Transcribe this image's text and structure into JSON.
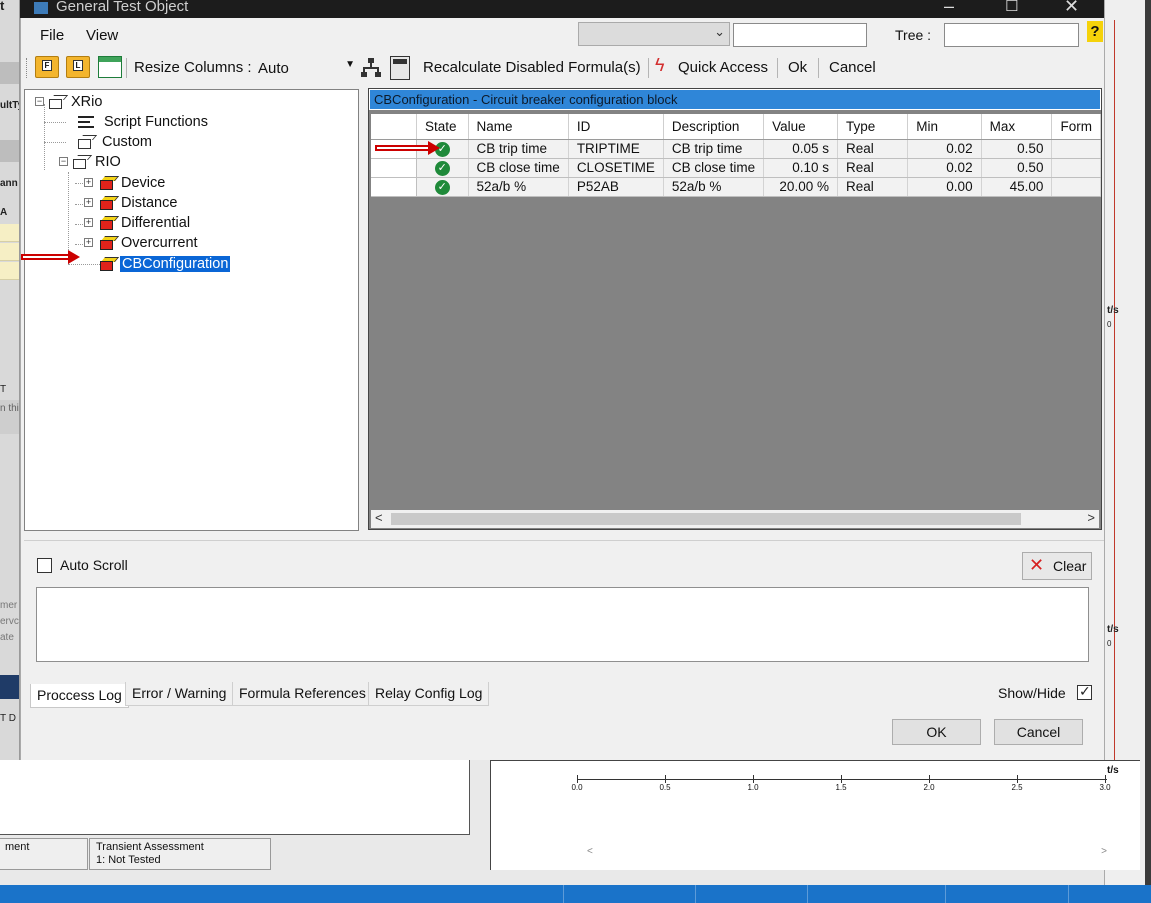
{
  "window": {
    "title": "General Test Object"
  },
  "menu": [
    "File",
    "View"
  ],
  "search": {
    "tree_label": "Tree :",
    "help": "?"
  },
  "toolbar": {
    "folder1": "F",
    "folder2": "L",
    "resize_label": "Resize Columns :",
    "resize_value": "Auto",
    "recalc_label": "Recalculate Disabled Formula(s)",
    "quick_access_label": "Quick Access",
    "ok_label": "Ok",
    "cancel_label": "Cancel"
  },
  "tree": [
    {
      "label": "XRio"
    },
    {
      "label": "Script Functions"
    },
    {
      "label": "Custom"
    },
    {
      "label": "RIO"
    },
    {
      "label": "Device"
    },
    {
      "label": "Distance"
    },
    {
      "label": "Differential"
    },
    {
      "label": "Overcurrent"
    },
    {
      "label": "CBConfiguration"
    }
  ],
  "grid": {
    "title": "CBConfiguration - Circuit breaker configuration block",
    "columns": [
      "State",
      "Name",
      "ID",
      "Description",
      "Value",
      "Type",
      "Min",
      "Max",
      "Form"
    ],
    "rows": [
      {
        "name": "CB trip time",
        "id": "TRIPTIME",
        "description": "CB trip time",
        "value": "0.05 s",
        "type": "Real",
        "min": "0.02",
        "max": "0.50"
      },
      {
        "name": "CB close time",
        "id": "CLOSETIME",
        "description": "CB close time",
        "value": "0.10 s",
        "type": "Real",
        "min": "0.02",
        "max": "0.50"
      },
      {
        "name": "52a/b %",
        "id": "P52AB",
        "description": "52a/b %",
        "value": "20.00 %",
        "type": "Real",
        "min": "0.00",
        "max": "45.00"
      }
    ]
  },
  "log": {
    "auto_scroll_label": "Auto Scroll",
    "clear_label": "Clear",
    "tabs": [
      "Proccess Log",
      "Error / Warning",
      "Formula References",
      "Relay Config Log"
    ],
    "show_hide_label": "Show/Hide"
  },
  "dialog_buttons": {
    "ok": "OK",
    "cancel": "Cancel"
  },
  "background": {
    "status_cell_1": "ment",
    "status_cell_2_title": "Transient Assessment",
    "status_cell_2_value": "1: Not Tested",
    "axis_unit": "t/s",
    "axis_ticks": [
      "0.0",
      "0.5",
      "1.0",
      "1.5",
      "2.0",
      "2.5",
      "3.0"
    ],
    "left_fragments": [
      "t",
      "ultTy",
      "ann",
      "A",
      "T",
      "n thi",
      "mer",
      "ervc",
      "ate",
      "T D"
    ],
    "right_fragments": [
      "t/s",
      "0",
      "t/s",
      "0"
    ]
  }
}
